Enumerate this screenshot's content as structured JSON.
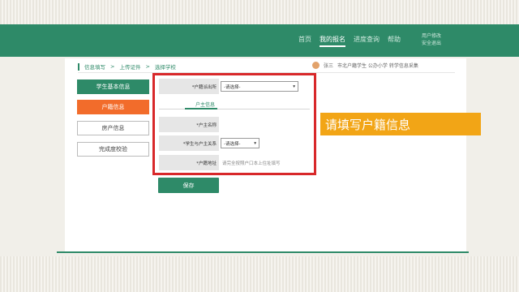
{
  "header": {
    "nav": [
      "首页",
      "我的报名",
      "进度查询",
      "帮助"
    ],
    "active_index": 1,
    "user_links": [
      "用户修改",
      "安全退出"
    ]
  },
  "breadcrumb": [
    "信息填写",
    "上传证件",
    "选择学校"
  ],
  "user_info": {
    "name": "张三",
    "school": "市北户籍学生 公办小学 转学信息采集"
  },
  "sidebar": [
    {
      "label": "学生基本信息",
      "style": "green"
    },
    {
      "label": "户籍信息",
      "style": "orange"
    },
    {
      "label": "房产信息",
      "style": "plain"
    },
    {
      "label": "完成度校验",
      "style": "plain"
    }
  ],
  "form": {
    "hukou_police_label": "*户籍派出所",
    "hukou_police_value": "-请选择-",
    "tab_label": "户主信息",
    "owner_name_label": "*户主名称",
    "owner_name_value": "",
    "relation_label": "*学生与户主关系",
    "relation_value": "-请选择-",
    "address_label": "*户籍地址",
    "address_placeholder": "请完全按照户口本上住址填写"
  },
  "save_label": "保存",
  "callout": "请填写户籍信息",
  "colors": {
    "brand": "#2e8a68",
    "accent": "#f26c2b",
    "highlight": "#d8282a",
    "callout": "#f2a516"
  }
}
